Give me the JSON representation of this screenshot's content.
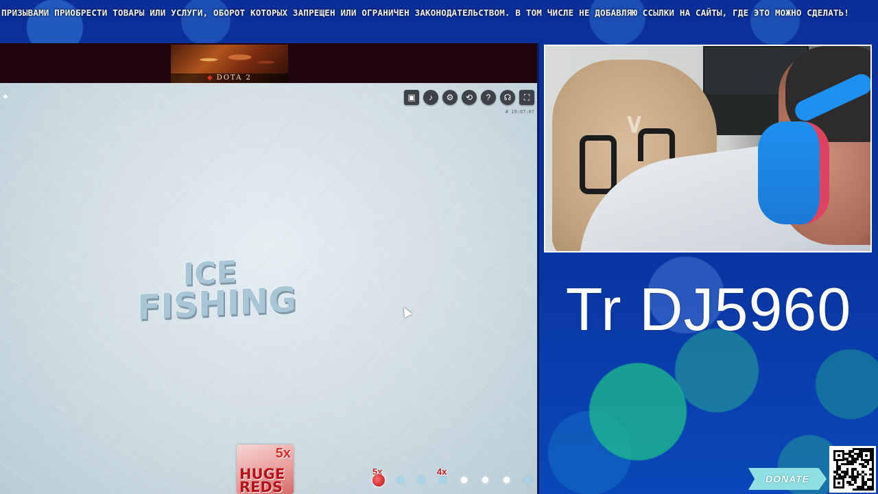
{
  "ticker": {
    "text": "ПРИЗЫВАМИ ПРИОБРЕСТИ ТОВАРЫ ИЛИ УСЛУГИ, ОБОРОТ КОТОРЫХ ЗАПРЕЩЕН ИЛИ ОГРАНИЧЕН ЗАКОНОДАТЕЛЬСТВОМ. В ТОМ ЧИСЛЕ НЕ ДОБАВЛЯЮ ССЫЛКИ НА САЙТЫ, ГДЕ ЭТО МОЖНО СДЕЛАТЬ!"
  },
  "game": {
    "banner_label": "DOTA 2",
    "title_line1": "ICE",
    "title_line2": "FISHING",
    "timestamp": "# 19:07:07",
    "controls": [
      {
        "name": "chat-icon",
        "glyph": "▣"
      },
      {
        "name": "volume-icon",
        "glyph": "🔊"
      },
      {
        "name": "settings-icon",
        "glyph": "⚙"
      },
      {
        "name": "history-icon",
        "glyph": "⟲"
      },
      {
        "name": "help-icon",
        "glyph": "?"
      },
      {
        "name": "headset-icon",
        "glyph": "☊"
      },
      {
        "name": "fullscreen-icon",
        "glyph": "⛶"
      }
    ],
    "bonus_card": {
      "multiplier": "5x",
      "name": "HUGE REDS"
    },
    "track": {
      "mult_left": "5x",
      "mult_right": "4x"
    }
  },
  "overlay": {
    "channel_tag": "Tr DJ5960",
    "donate_label": "DONATE"
  },
  "colors": {
    "background": "#0b2f9a",
    "accent_teal": "#1ebe8c",
    "donate": "#8fe0e4"
  }
}
